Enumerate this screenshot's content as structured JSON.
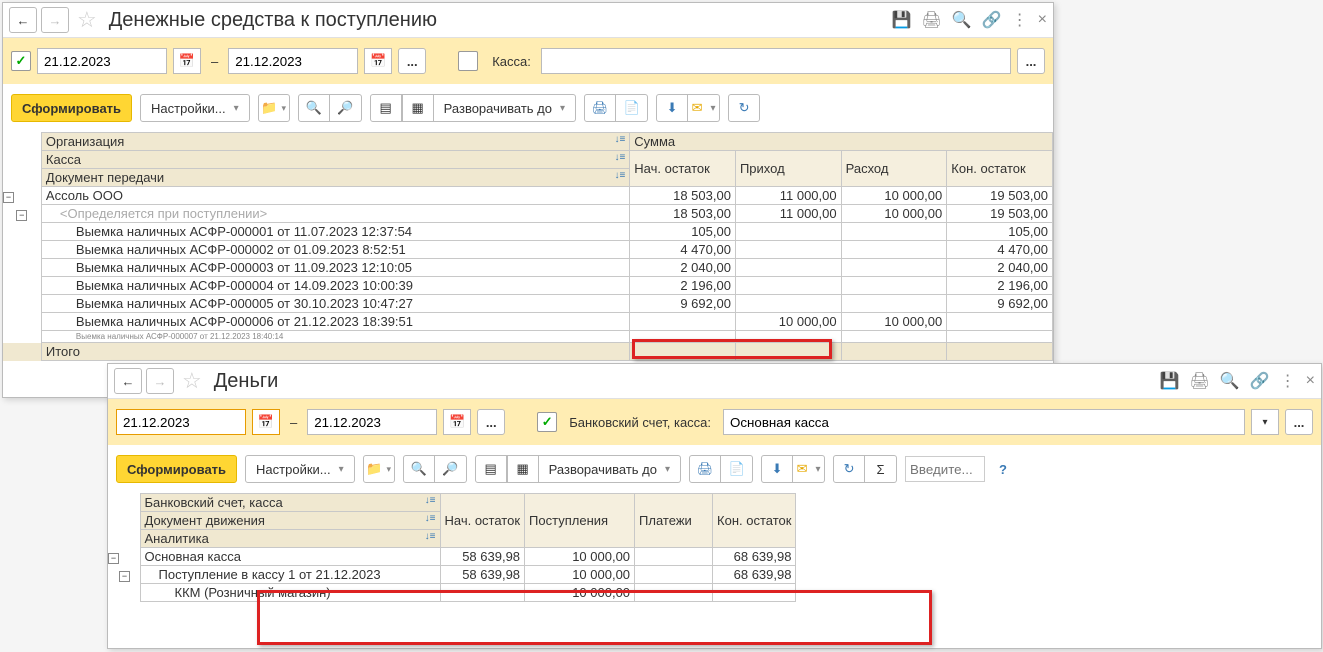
{
  "win1": {
    "title": "Денежные средства к поступлению",
    "filter": {
      "checked": true,
      "date_from": "21.12.2023",
      "date_to": "21.12.2023",
      "kassa_label": "Касса:",
      "kassa_value": ""
    },
    "toolbar": {
      "form": "Сформировать",
      "settings": "Настройки...",
      "expand": "Разворачивать до"
    },
    "headers": {
      "org": "Организация",
      "kassa": "Касса",
      "doc": "Документ передачи",
      "sum": "Сумма",
      "start": "Нач. остаток",
      "income": "Приход",
      "expense": "Расход",
      "end": "Кон. остаток"
    },
    "rows": [
      {
        "label": "Ассоль ООО",
        "start": "18 503,00",
        "income": "11 000,00",
        "expense": "10 000,00",
        "end": "19 503,00",
        "lvl": 0
      },
      {
        "label": "<Определяется при поступлении>",
        "start": "18 503,00",
        "income": "11 000,00",
        "expense": "10 000,00",
        "end": "19 503,00",
        "lvl": 1,
        "ph": true
      },
      {
        "label": "Выемка наличных АСФР-000001 от 11.07.2023 12:37:54",
        "start": "105,00",
        "income": "",
        "expense": "",
        "end": "105,00",
        "lvl": 2
      },
      {
        "label": "Выемка наличных АСФР-000002 от 01.09.2023 8:52:51",
        "start": "4 470,00",
        "income": "",
        "expense": "",
        "end": "4 470,00",
        "lvl": 2
      },
      {
        "label": "Выемка наличных АСФР-000003 от 11.09.2023 12:10:05",
        "start": "2 040,00",
        "income": "",
        "expense": "",
        "end": "2 040,00",
        "lvl": 2
      },
      {
        "label": "Выемка наличных АСФР-000004 от 14.09.2023 10:00:39",
        "start": "2 196,00",
        "income": "",
        "expense": "",
        "end": "2 196,00",
        "lvl": 2
      },
      {
        "label": "Выемка наличных АСФР-000005 от 30.10.2023 10:47:27",
        "start": "9 692,00",
        "income": "",
        "expense": "",
        "end": "9 692,00",
        "lvl": 2
      },
      {
        "label": "Выемка наличных АСФР-000006 от 21.12.2023 18:39:51",
        "start": "",
        "income": "10 000,00",
        "expense": "10 000,00",
        "end": "",
        "lvl": 2,
        "hl": true
      },
      {
        "label": "Выемка наличных АСФР-000007 от 21.12.2023 18:40:14",
        "start": "",
        "income": "",
        "expense": "",
        "end": "",
        "lvl": 2,
        "cut": true
      }
    ],
    "total_label": "Итого"
  },
  "win2": {
    "title": "Деньги",
    "filter": {
      "date_from": "21.12.2023",
      "date_to": "21.12.2023",
      "acct_label": "Банковский счет, касса:",
      "acct_value": "Основная касса",
      "checked": true
    },
    "toolbar": {
      "form": "Сформировать",
      "settings": "Настройки...",
      "expand": "Разворачивать до",
      "search_ph": "Введите..."
    },
    "headers": {
      "acct": "Банковский счет, касса",
      "doc": "Документ движения",
      "anal": "Аналитика",
      "start": "Нач. остаток",
      "income": "Поступления",
      "expense": "Платежи",
      "end": "Кон. остаток"
    },
    "rows": [
      {
        "label": "Основная касса",
        "start": "58 639,98",
        "income": "10 000,00",
        "expense": "",
        "end": "68 639,98",
        "lvl": 0
      },
      {
        "label": "Поступление в кассу 1 от 21.12.2023",
        "start": "58 639,98",
        "income": "10 000,00",
        "expense": "",
        "end": "68 639,98",
        "lvl": 1
      },
      {
        "label": "ККМ (Розничный магазин)",
        "start": "",
        "income": "10 000,00",
        "expense": "",
        "end": "",
        "lvl": 2
      }
    ]
  },
  "icons": {
    "back": "←",
    "fwd": "→",
    "star": "☆",
    "save": "💾",
    "print": "🖨",
    "preview": "🔍",
    "link": "🔗",
    "more": "⋮",
    "close": "×",
    "cal": "📅",
    "dots": "...",
    "find": "🔍",
    "findnext": "🔎",
    "expand1": "▤",
    "expand2": "▦",
    "dl": "⬇",
    "mail": "✉",
    "refresh": "↻",
    "sigma": "Σ",
    "help": "?",
    "folder": "📁",
    "dd": "▾"
  }
}
